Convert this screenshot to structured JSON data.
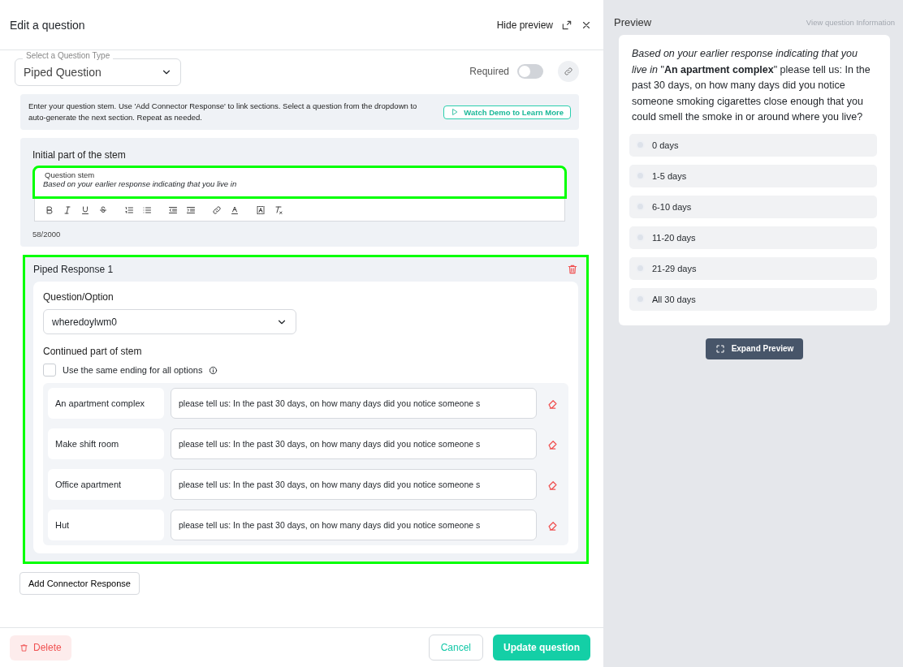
{
  "dialog": {
    "title": "Edit a question",
    "hide_preview": "Hide preview"
  },
  "question_type": {
    "label": "Select a Question Type",
    "value": "Piped Question"
  },
  "required": {
    "label": "Required",
    "on": false
  },
  "info": {
    "text": "Enter your question stem. Use 'Add Connector Response' to link sections. Select a question from the dropdown to auto-generate the next section. Repeat as needed.",
    "demo_button": "Watch Demo to Learn More"
  },
  "stem": {
    "section_label": "Initial part of the stem",
    "field_label": "Question stem",
    "value": "Based on your earlier response indicating that you live in",
    "count": "58/2000",
    "highlighted": true
  },
  "piped_responses": [
    {
      "title": "Piped Response 1",
      "highlighted": true,
      "question_label": "Question/Option",
      "question_value": "wheredoylwm0",
      "continued_label": "Continued part of stem",
      "same_ending": {
        "label": "Use the same ending for all options",
        "checked": false
      },
      "options": [
        {
          "option": "An apartment complex",
          "ending": "please tell us: In the past 30 days, on how many days did you notice someone s"
        },
        {
          "option": "Make shift room",
          "ending": "please tell us: In the past 30 days, on how many days did you notice someone s"
        },
        {
          "option": "Office apartment",
          "ending": "please tell us: In the past 30 days, on how many days did you notice someone s"
        },
        {
          "option": "Hut",
          "ending": "please tell us: In the past 30 days, on how many days did you notice someone s"
        }
      ]
    }
  ],
  "add_connector": "Add Connector Response",
  "footer": {
    "delete": "Delete",
    "cancel": "Cancel",
    "update": "Update question"
  },
  "preview": {
    "title": "Preview",
    "info_link": "View question Information",
    "question": "*Based on your earlier response indicating that you live in* \"**An apartment complex**\" please tell us: In the past 30 days, on how many days did you notice someone smoking cigarettes close enough that you could smell the smoke in or around where you live?",
    "choices": [
      {
        "label": "0 days",
        "selected": false
      },
      {
        "label": "1-5 days",
        "selected": false
      },
      {
        "label": "6-10 days",
        "selected": false
      },
      {
        "label": "11-20 days",
        "selected": false
      },
      {
        "label": "21-29 days",
        "selected": false
      },
      {
        "label": "All 30 days",
        "selected": false
      }
    ],
    "expand_button": "Expand Preview"
  }
}
